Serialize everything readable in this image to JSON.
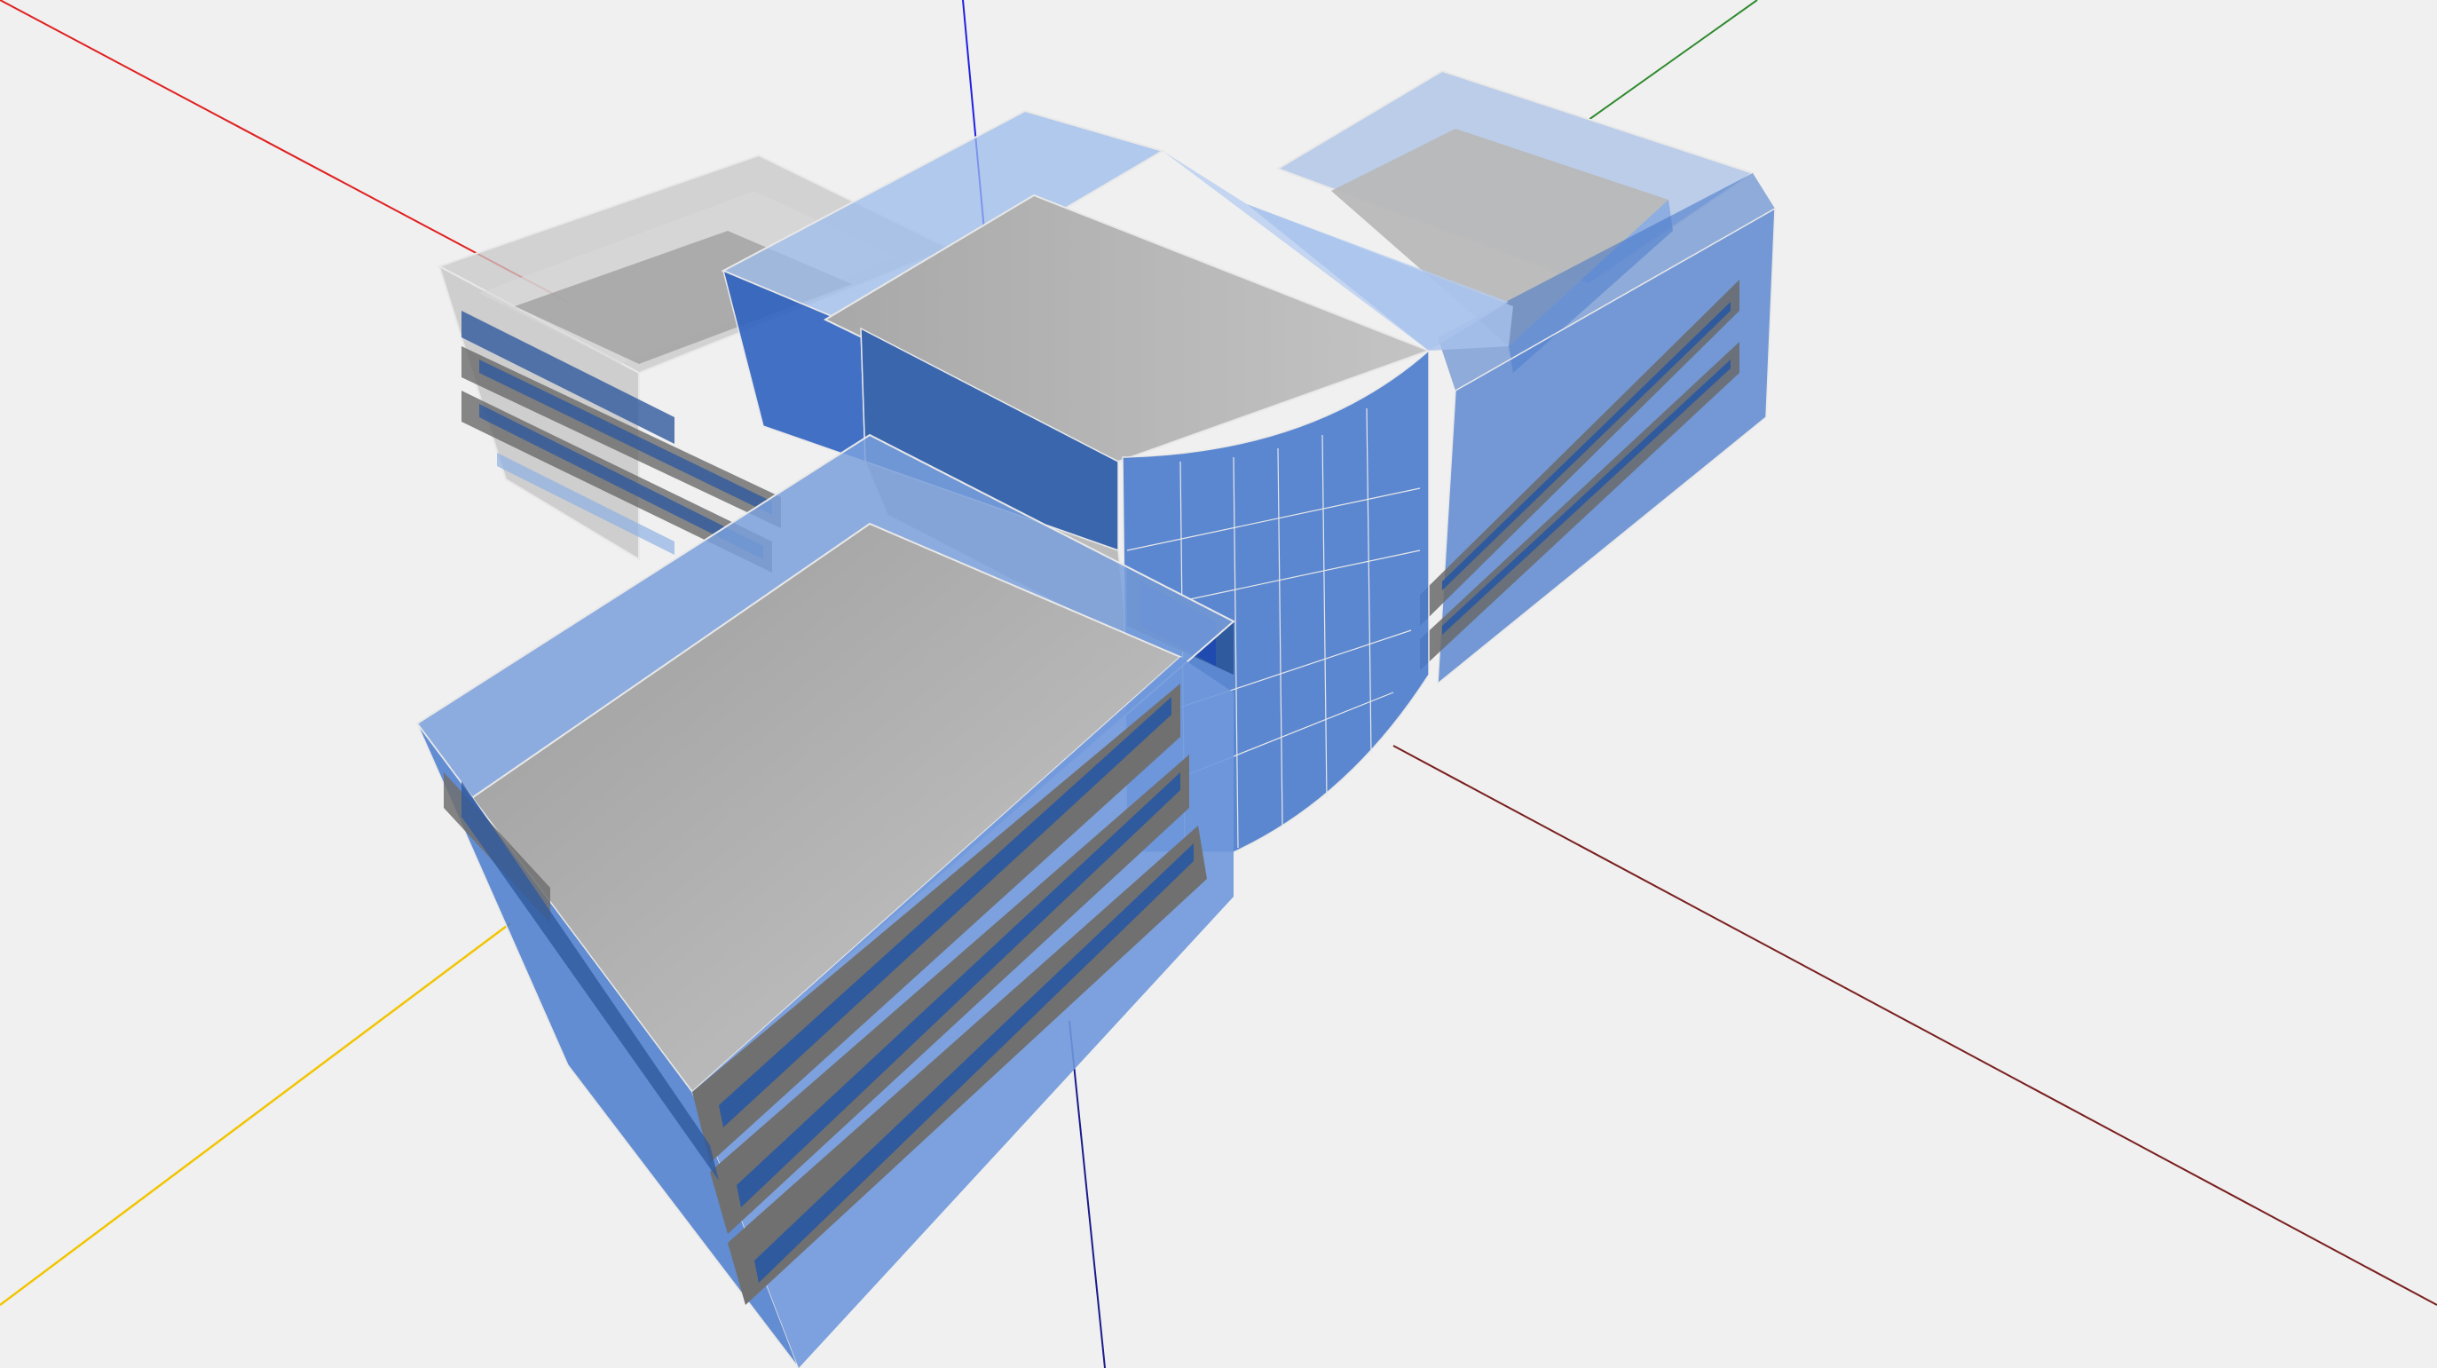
{
  "viewport": {
    "background_color": "#f0f0f0",
    "axes": {
      "x_positive_color": "#e02020",
      "x_negative_color": "#7a1f1f",
      "y_positive_color": "#2e8a2e",
      "y_negative_color": "#f2c400",
      "z_positive_color": "#2020e0",
      "z_negative_color": "#1a1a8a"
    },
    "model": {
      "roof_color": "#b4b4b4",
      "glass_color": "#5b8fd8",
      "glass_dark_color": "#2f5a9e",
      "wall_gray_color": "#7a7a7a",
      "edge_color": "#e8e8e8"
    }
  }
}
